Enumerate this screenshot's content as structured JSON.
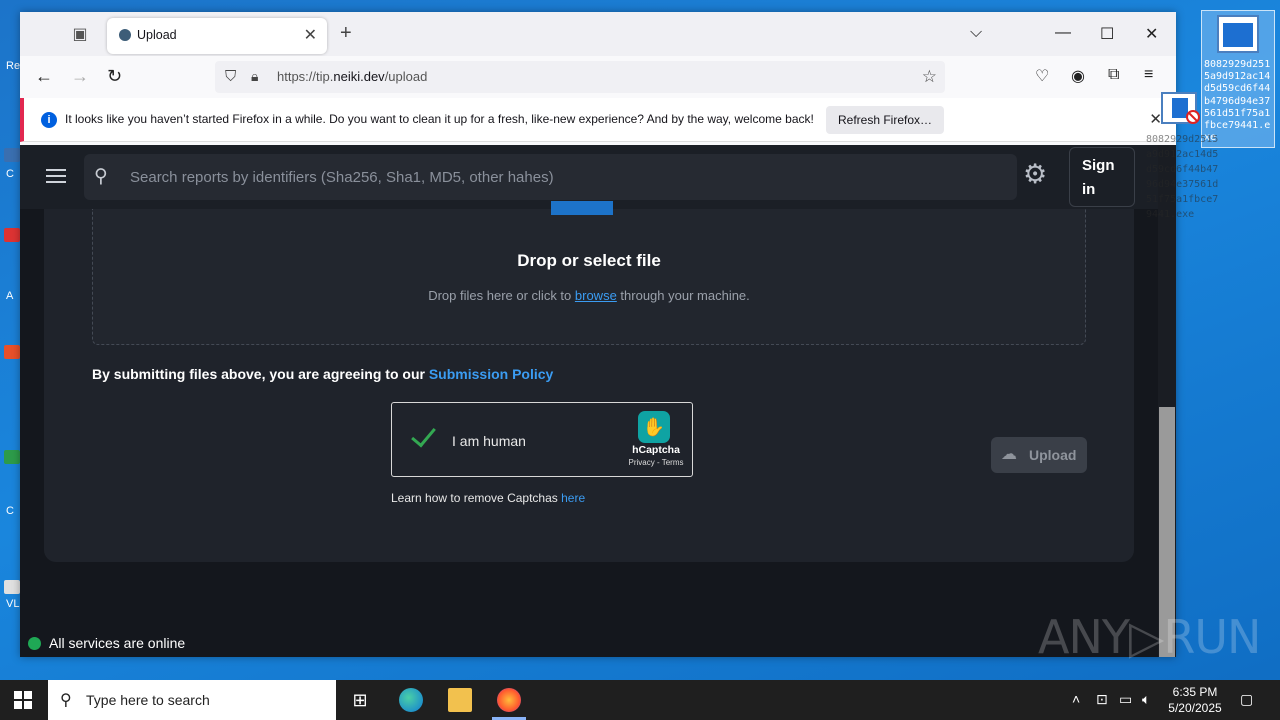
{
  "desktop": {
    "left_labels": [
      "Re",
      "C",
      "A",
      "C",
      "VL"
    ],
    "file_name": "8082929d2515a9d912ac14d5d59cd6f44b4796d94e37561d51f75a1fbce79441.exe"
  },
  "browser": {
    "tab_title": "Upload",
    "url_prefix": "https://tip.",
    "url_domain": "neiki.dev",
    "url_path": "/upload",
    "infobar_message": "It looks like you haven’t started Firefox in a while. Do you want to clean it up for a fresh, like-new experience? And by the way, welcome back!",
    "infobar_button": "Refresh Firefox…"
  },
  "page": {
    "search_placeholder": "Search reports by identifiers (Sha256, Sha1, MD5, other hahes)",
    "signin_label": "Sign in",
    "drop_title": "Drop or select file",
    "drop_sub_before": "Drop files here or click to ",
    "drop_sub_link": "browse",
    "drop_sub_after": " through your machine.",
    "policy_text": "By submitting files above, you are agreeing to our ",
    "policy_link": "Submission Policy",
    "captcha_label": "I am human",
    "captcha_brand": "hCaptcha",
    "captcha_terms": "Privacy - Terms",
    "remove_text": "Learn how to remove Captchas ",
    "remove_link": "here",
    "upload_label": "Upload",
    "status_text": "All services are online"
  },
  "watermark": "ANY▷RUN",
  "taskbar": {
    "search_placeholder": "Type here to search",
    "time": "6:35 PM",
    "date": "5/20/2025"
  },
  "colors": {
    "accent_link": "#3b9cf2",
    "status_online": "#1fa855",
    "infobar_accent": "#e22850"
  }
}
